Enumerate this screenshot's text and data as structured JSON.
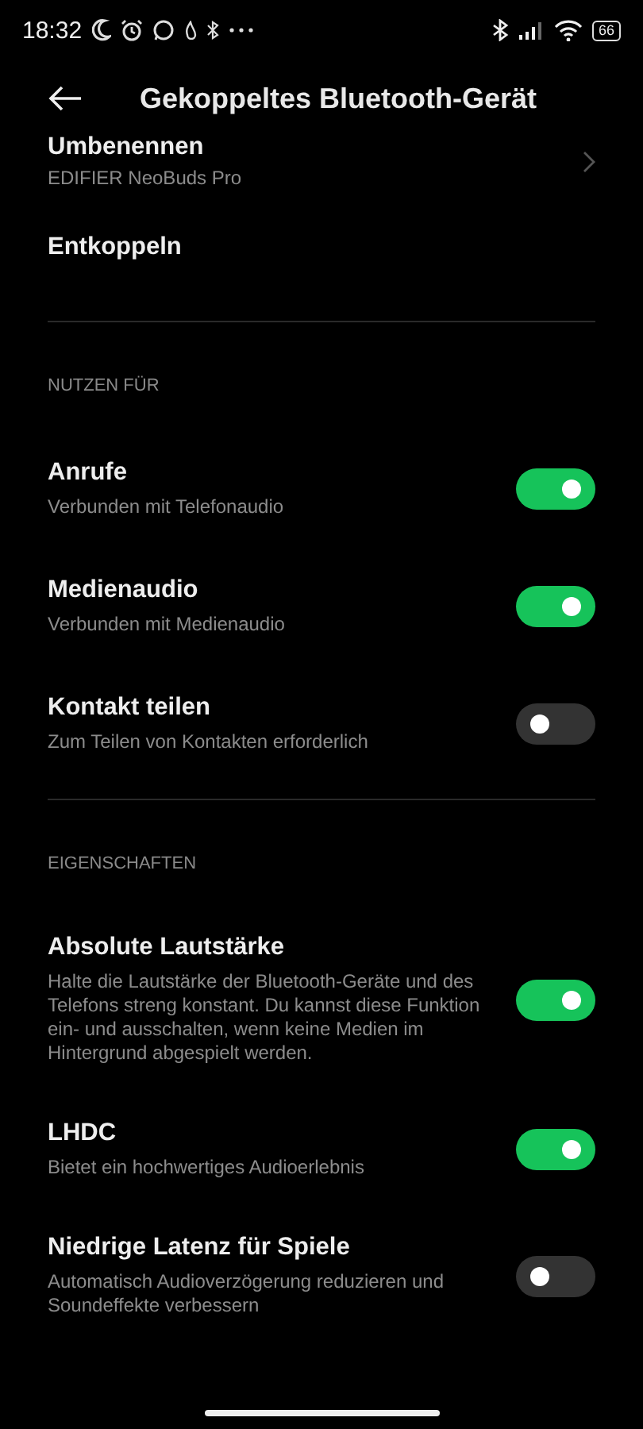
{
  "status_bar": {
    "time": "18:32",
    "battery": "66"
  },
  "header": {
    "title": "Gekoppeltes Bluetooth-Gerät"
  },
  "top_items": [
    {
      "kind": "link",
      "title": "Umbenennen",
      "subtitle": "EDIFIER NeoBuds Pro"
    },
    {
      "kind": "action",
      "title": "Entkoppeln"
    }
  ],
  "sections": [
    {
      "title": "NUTZEN FÜR",
      "items": [
        {
          "title": "Anrufe",
          "subtitle": "Verbunden mit Telefonaudio",
          "on": true
        },
        {
          "title": "Medienaudio",
          "subtitle": "Verbunden mit Medienaudio",
          "on": true
        },
        {
          "title": "Kontakt teilen",
          "subtitle": "Zum Teilen von Kontakten erforderlich",
          "on": false
        }
      ]
    },
    {
      "title": "EIGENSCHAFTEN",
      "items": [
        {
          "title": "Absolute Lautstärke",
          "subtitle": "Halte die Lautstärke der Bluetooth-Geräte und des Telefons streng konstant. Du kannst diese Funktion ein- und ausschalten, wenn keine Medien im Hintergrund abgespielt werden.",
          "on": true
        },
        {
          "title": "LHDC",
          "subtitle": "Bietet ein hochwertiges Audioerlebnis",
          "on": true
        },
        {
          "title": "Niedrige Latenz für Spiele",
          "subtitle": "Automatisch Audioverzögerung reduzieren und Soundeffekte verbessern",
          "on": false
        }
      ]
    }
  ]
}
